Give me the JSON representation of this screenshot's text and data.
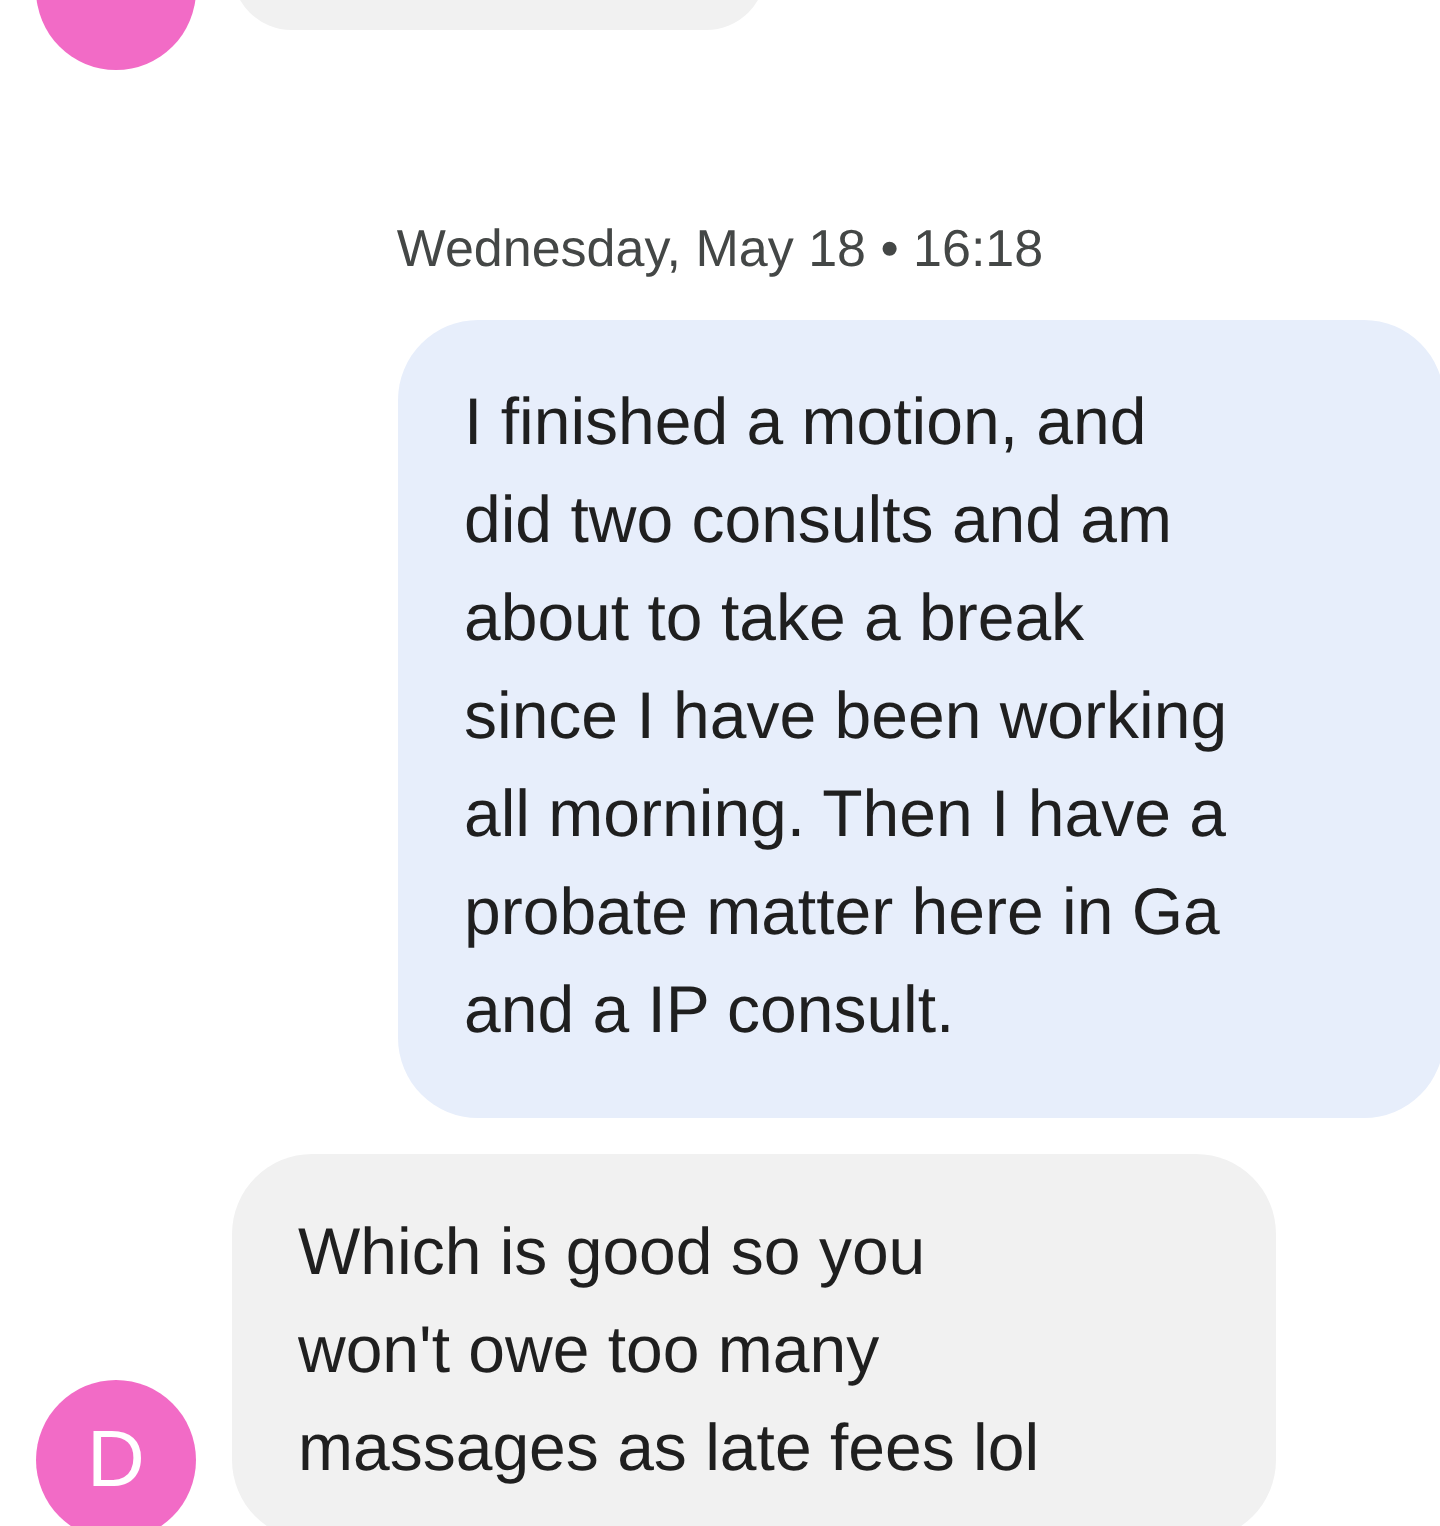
{
  "messages": [
    {
      "kind": "received_cut"
    },
    {
      "kind": "date",
      "text": "Wednesday, May 18 • 16:18"
    },
    {
      "kind": "sent",
      "text": "I finished a motion, and\ndid two consults and am\nabout to take a break\nsince I have been working\nall morning. Then I have a\nprobate matter here in Ga\nand a IP consult."
    },
    {
      "kind": "received",
      "avatar": "D",
      "text": "Which is good so you\nwon't owe too many\nmassages as late fees lol"
    }
  ]
}
